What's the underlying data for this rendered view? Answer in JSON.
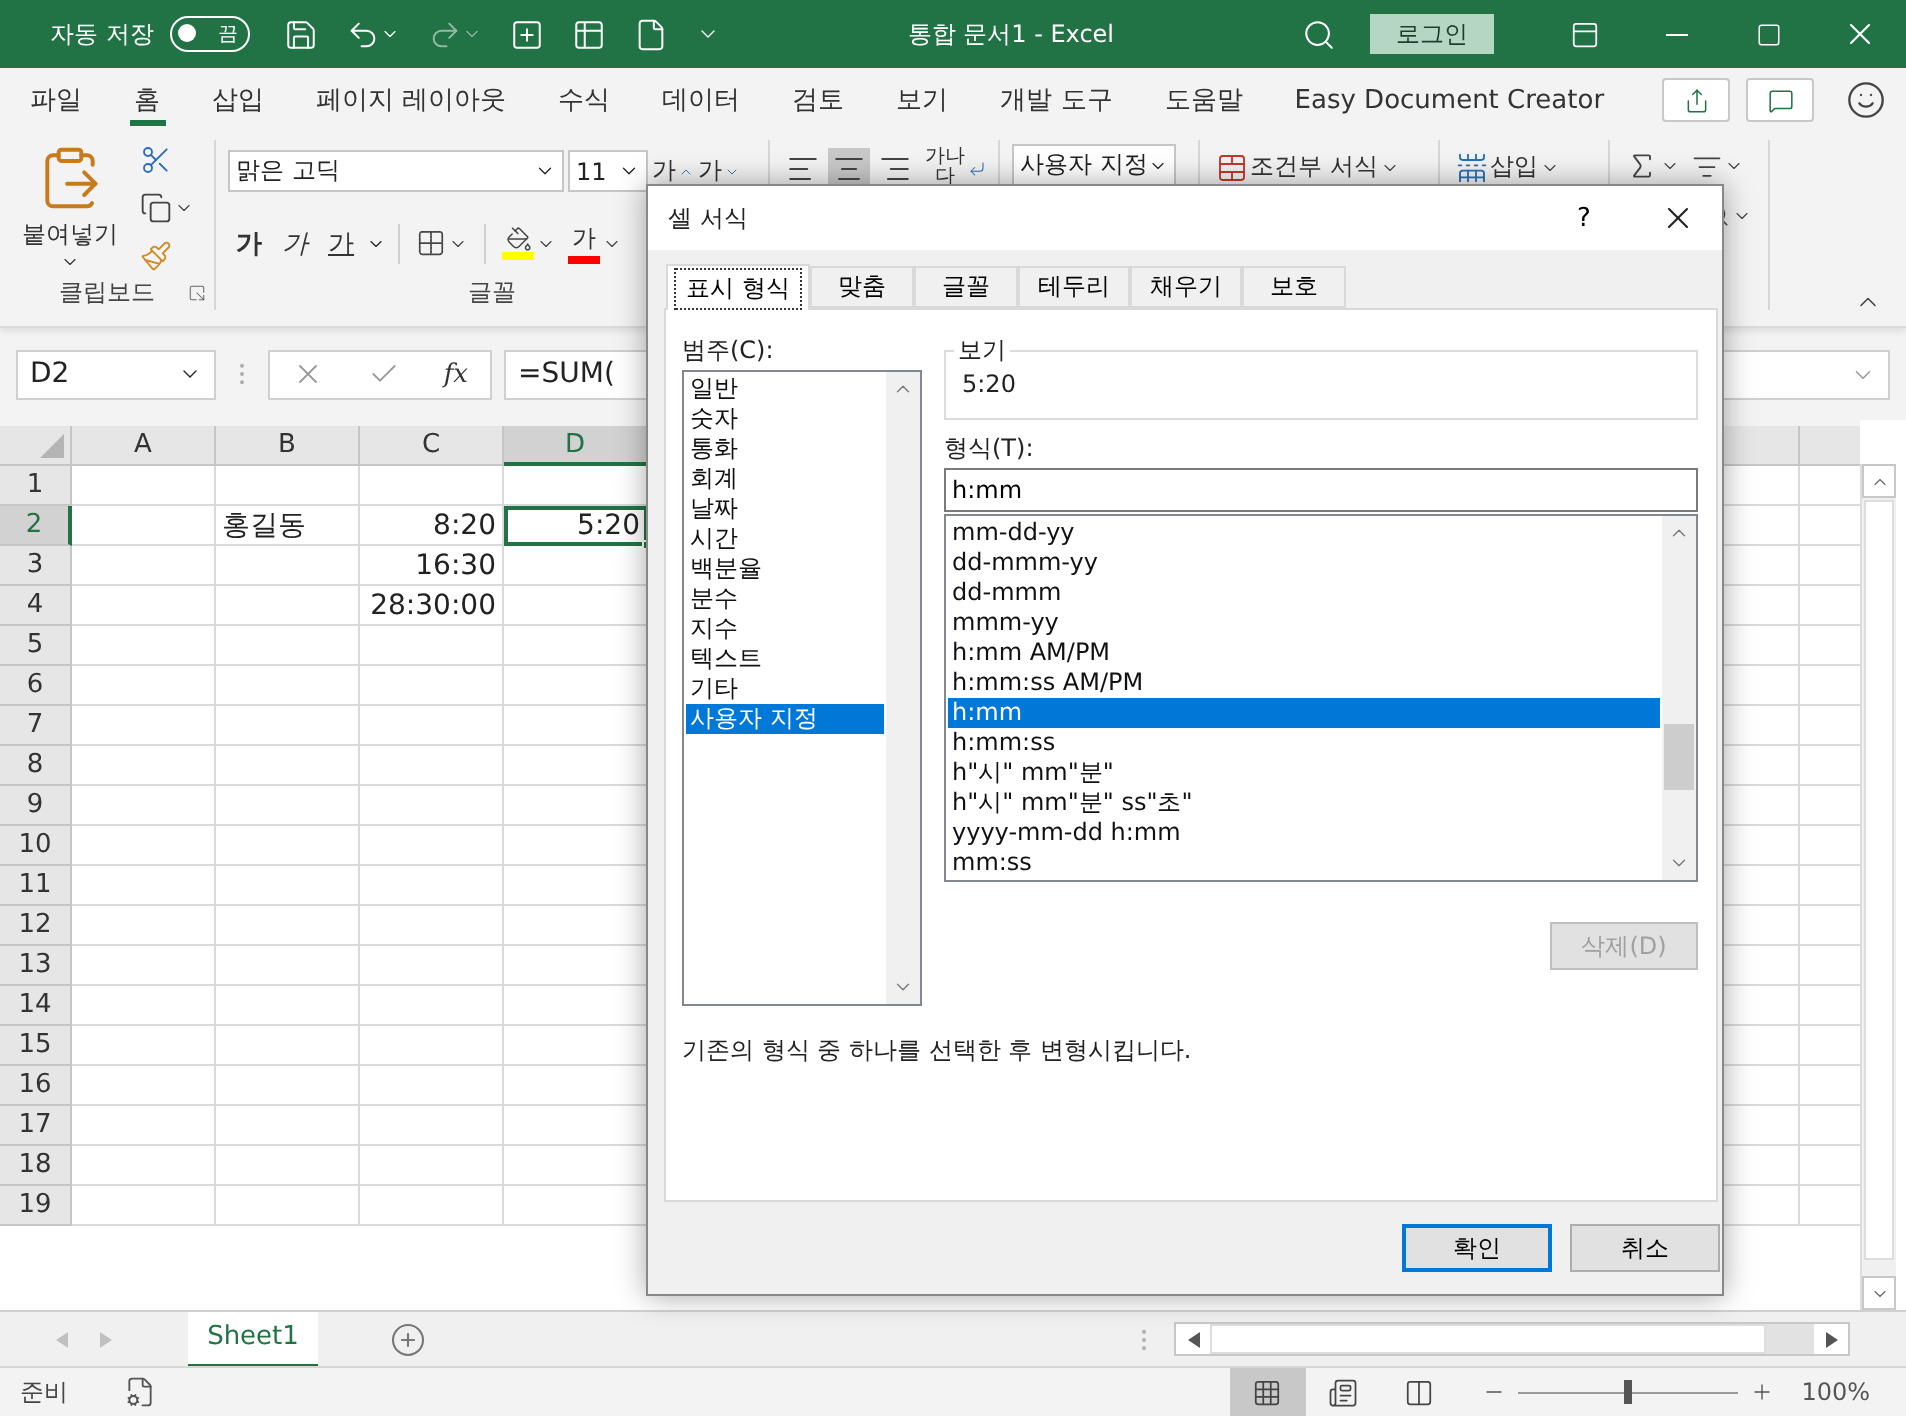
{
  "window": {
    "autosave_label": "자동 저장",
    "autosave_toggle": "끔",
    "autosave_on": false,
    "title": "통합 문서1  -  Excel",
    "login": "로그인"
  },
  "menu_tabs": [
    {
      "label": "파일",
      "selected": false
    },
    {
      "label": "홈",
      "selected": true
    },
    {
      "label": "삽입",
      "selected": false
    },
    {
      "label": "페이지 레이아웃",
      "selected": false
    },
    {
      "label": "수식",
      "selected": false
    },
    {
      "label": "데이터",
      "selected": false
    },
    {
      "label": "검토",
      "selected": false
    },
    {
      "label": "보기",
      "selected": false
    },
    {
      "label": "개발 도구",
      "selected": false
    },
    {
      "label": "도움말",
      "selected": false
    },
    {
      "label": "Easy Document Creator",
      "selected": false
    }
  ],
  "ribbon": {
    "paste": "붙여넣기",
    "clipboard_label": "클립보드",
    "font_name": "맑은 고딕",
    "font_size": "11",
    "grow_font": "가",
    "shrink_font": "가",
    "bold": "가",
    "italic": "가",
    "underline": "가",
    "font_color": "가",
    "font_label": "글꼴",
    "wrap_text": "가나다",
    "number_format": "사용자 지정",
    "conditional_format": "조건부 서식",
    "insert": "삽입"
  },
  "formula_bar": {
    "cell_ref": "D2",
    "function_symbol": "fx",
    "formula": "=SUM("
  },
  "sheet": {
    "columns": [
      {
        "label": "A",
        "selected": false
      },
      {
        "label": "B",
        "selected": false
      },
      {
        "label": "C",
        "selected": false
      },
      {
        "label": "D",
        "selected": true
      }
    ],
    "rows": [
      {
        "label": "1",
        "selected": false
      },
      {
        "label": "2",
        "selected": true,
        "cells": [
          null,
          {
            "text": "홍길동",
            "kind": "text"
          },
          {
            "text": "8:20",
            "kind": "number"
          },
          {
            "text": "5:20",
            "kind": "number"
          }
        ]
      },
      {
        "label": "3",
        "selected": false,
        "cells": [
          null,
          null,
          {
            "text": "16:30",
            "kind": "number"
          }
        ]
      },
      {
        "label": "4",
        "selected": false,
        "cells": [
          null,
          null,
          {
            "text": "28:30:00",
            "kind": "number"
          }
        ]
      },
      {
        "label": "5",
        "selected": false
      },
      {
        "label": "6",
        "selected": false
      },
      {
        "label": "7",
        "selected": false
      },
      {
        "label": "8",
        "selected": false
      },
      {
        "label": "9",
        "selected": false
      },
      {
        "label": "10",
        "selected": false
      },
      {
        "label": "11",
        "selected": false
      },
      {
        "label": "12",
        "selected": false
      },
      {
        "label": "13",
        "selected": false
      },
      {
        "label": "14",
        "selected": false
      },
      {
        "label": "15",
        "selected": false
      },
      {
        "label": "16",
        "selected": false
      },
      {
        "label": "17",
        "selected": false
      },
      {
        "label": "18",
        "selected": false
      },
      {
        "label": "19",
        "selected": false
      }
    ]
  },
  "sheet_tabs": [
    {
      "label": "Sheet1",
      "selected": true
    }
  ],
  "status_bar": {
    "text": "준비",
    "views": [
      {
        "kind": "normal",
        "selected": true
      },
      {
        "kind": "page_layout",
        "selected": false
      },
      {
        "kind": "page_break",
        "selected": false
      }
    ],
    "zoom_slider": {
      "level": 0.5
    },
    "zoom": "100%"
  },
  "dialog": {
    "title": "셀 서식",
    "help": "?",
    "tabs": [
      {
        "label": "표시 형식",
        "selected": true
      },
      {
        "label": "맞춤",
        "selected": false
      },
      {
        "label": "글꼴",
        "selected": false
      },
      {
        "label": "테두리",
        "selected": false
      },
      {
        "label": "채우기",
        "selected": false
      },
      {
        "label": "보호",
        "selected": false
      }
    ],
    "category_label": "범주(C):",
    "categories": [
      {
        "label": "일반",
        "selected": false
      },
      {
        "label": "숫자",
        "selected": false
      },
      {
        "label": "통화",
        "selected": false
      },
      {
        "label": "회계",
        "selected": false
      },
      {
        "label": "날짜",
        "selected": false
      },
      {
        "label": "시간",
        "selected": false
      },
      {
        "label": "백분율",
        "selected": false
      },
      {
        "label": "분수",
        "selected": false
      },
      {
        "label": "지수",
        "selected": false
      },
      {
        "label": "텍스트",
        "selected": false
      },
      {
        "label": "기타",
        "selected": false
      },
      {
        "label": "사용자 지정",
        "selected": true
      }
    ],
    "preview_label": "보기",
    "preview": "5:20",
    "type_label": "형식(T):",
    "type_value": "h:mm",
    "formats": [
      {
        "label": "mm-dd-yy",
        "selected": false
      },
      {
        "label": "dd-mmm-yy",
        "selected": false
      },
      {
        "label": "dd-mmm",
        "selected": false
      },
      {
        "label": "mmm-yy",
        "selected": false
      },
      {
        "label": "h:mm AM/PM",
        "selected": false
      },
      {
        "label": "h:mm:ss AM/PM",
        "selected": false
      },
      {
        "label": "h:mm",
        "selected": true
      },
      {
        "label": "h:mm:ss",
        "selected": false
      },
      {
        "label": "h\"시\" mm\"분\"",
        "selected": false
      },
      {
        "label": "h\"시\" mm\"분\" ss\"초\"",
        "selected": false
      },
      {
        "label": "yyyy-mm-dd h:mm",
        "selected": false
      },
      {
        "label": "mm:ss",
        "selected": false
      }
    ],
    "delete": {
      "label": "삭제(D)",
      "disabled": true
    },
    "description": "기존의 형식 중 하나를 선택한 후 변형시킵니다.",
    "buttons": [
      {
        "label": "확인",
        "default": true
      },
      {
        "label": "취소",
        "default": false
      }
    ]
  }
}
